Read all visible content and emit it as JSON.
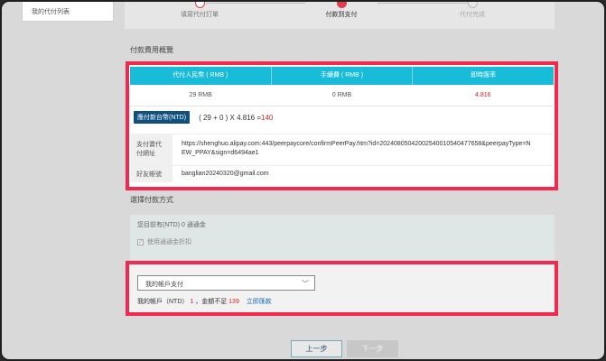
{
  "sidebar": {
    "title": "我的代付列表"
  },
  "steps": [
    {
      "label": "填寫代付訂單",
      "state": "done"
    },
    {
      "label": "付款到支付",
      "state": "active"
    },
    {
      "label": "代付完成",
      "state": "pending"
    }
  ],
  "fee_section": {
    "title": "付款費用概覽",
    "headers": [
      "代付人民幣 ( RMB )",
      "手續費 ( RMB )",
      "即時匯率"
    ],
    "values": [
      "29 RMB",
      "0 RMB",
      "4.816"
    ],
    "convert_button": "應付新台幣(NTD)",
    "calc_prefix": "( 29 + 0 ) X 4.816 = ",
    "calc_result": "140",
    "pay_link_label": "支付寶代付網址",
    "pay_link_url": "https://shenghuo.alipay.com:443/peerpaycore/confirmPeerPay.htm?id=20240805042002540010540477658&peerpayType=NEW_PPAY&sign=d6494ae1",
    "friend_label": "好友帳號",
    "friend_value": "banglian20240320@gmail.com"
  },
  "method_section": {
    "title": "選擇付款方式",
    "balance_text": "您目前有(NTD) 0 通通金",
    "checkbox_label": "使用通通金折扣"
  },
  "account_section": {
    "select_value": "我的帳戶支付",
    "balance_prefix": "我的帳戶（NTD）",
    "balance_amount": "1",
    "shortfall_prefix": "，金額不足 ",
    "shortfall_amount": "139",
    "topup_link": "立即匯款"
  },
  "buttons": {
    "prev": "上一步",
    "next": "下一步"
  },
  "colors": {
    "highlight": "#f2294f",
    "table_header": "#18bcd8",
    "accent_button": "#10507e"
  }
}
